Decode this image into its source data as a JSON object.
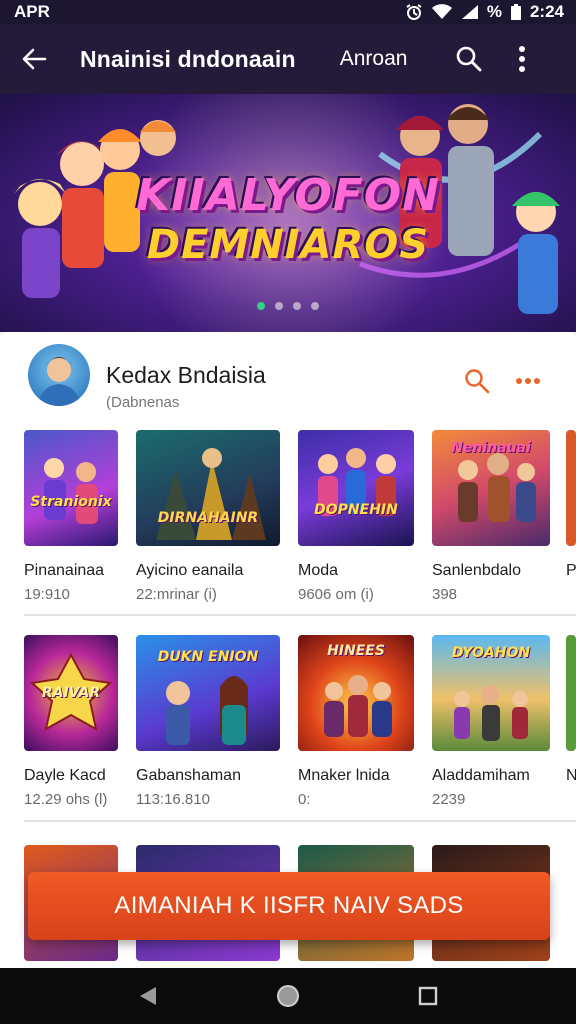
{
  "status_bar": {
    "left_text": "APR",
    "battery_text": "%",
    "time": "2:24"
  },
  "app_bar": {
    "title": "Nnainisi dndonaain",
    "action_text": "Anroan"
  },
  "banner": {
    "title_line1": "KIIALYOFON",
    "title_line2": "DEMNIAROS",
    "active_dot": 0,
    "dot_count": 4
  },
  "developer": {
    "name": "Kedax Bndaisia",
    "subtitle": "(Dabnenas"
  },
  "rows": [
    [
      {
        "thumb_text": "Stranionix",
        "name": "Pinanainaa",
        "meta": "19:910"
      },
      {
        "thumb_text": "DIRNAHAINR",
        "name": "Ayicino eanaila",
        "meta": "22:mrinar (i)"
      },
      {
        "thumb_text": "DOPNEHIN",
        "name": "Moda",
        "meta": "9606 om (i)"
      },
      {
        "thumb_text": "Neninauai",
        "name": "Sanlenbdalo",
        "meta": "398"
      },
      {
        "thumb_text": "",
        "name": "P",
        "meta": ""
      }
    ],
    [
      {
        "thumb_text": "RAIVAR",
        "name": "Dayle Kacd",
        "meta": "12.29 ohs (l)"
      },
      {
        "thumb_text": "DUKN ENION",
        "name": "Gabanshaman",
        "meta": "113:16.810"
      },
      {
        "thumb_text": "HINEES",
        "name": "Mnaker lnida",
        "meta": "0:"
      },
      {
        "thumb_text": "DYOAHON",
        "name": "Aladdamiham",
        "meta": "2239"
      },
      {
        "thumb_text": "",
        "name": "N",
        "meta": ""
      }
    ]
  ],
  "cta": {
    "label": "AIMANIAH K IISFR NAIV SADS"
  },
  "colors": {
    "accent": "#e8642a",
    "app_bar": "#241b3b",
    "active_dot": "#35d07f"
  },
  "icons": [
    "back-arrow-icon",
    "search-icon",
    "more-vert-icon",
    "nav-back-icon",
    "nav-home-icon",
    "nav-recents-icon"
  ]
}
